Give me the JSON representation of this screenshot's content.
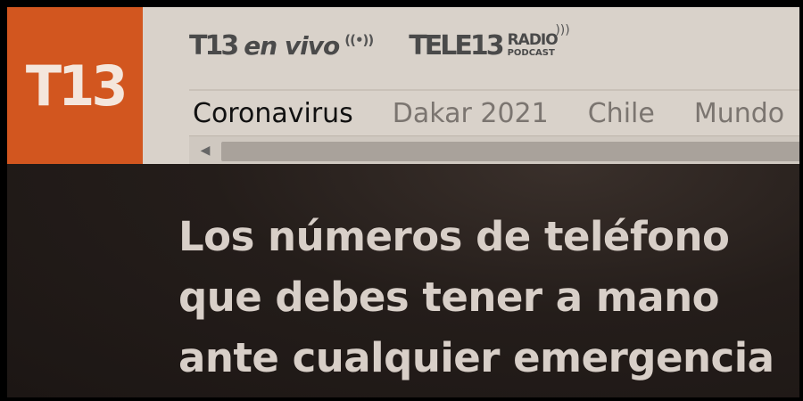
{
  "logo": {
    "text": "T13"
  },
  "top_links": {
    "live": {
      "brand": "T13",
      "label": "en vivo",
      "icon": "broadcast-icon"
    },
    "radio": {
      "brand": "TELE13",
      "label": "RADIO",
      "sublabel": "PODCAST",
      "icon": "broadcast-icon"
    }
  },
  "nav": {
    "items": [
      {
        "label": "Coronavirus",
        "active": true
      },
      {
        "label": "Dakar 2021",
        "active": false
      },
      {
        "label": "Chile",
        "active": false
      },
      {
        "label": "Mundo",
        "active": false
      }
    ]
  },
  "scrollbar": {
    "arrow_icon": "triangle-left-icon",
    "arrow_glyph": "◀"
  },
  "article": {
    "headline_lines": [
      "Los números de teléfono",
      "que debes tener a mano",
      "ante cualquier emergencia"
    ]
  },
  "colors": {
    "brand_orange": "#d2561f",
    "header_bg": "#d9d2ca",
    "headline_text": "#d8cfc8"
  }
}
